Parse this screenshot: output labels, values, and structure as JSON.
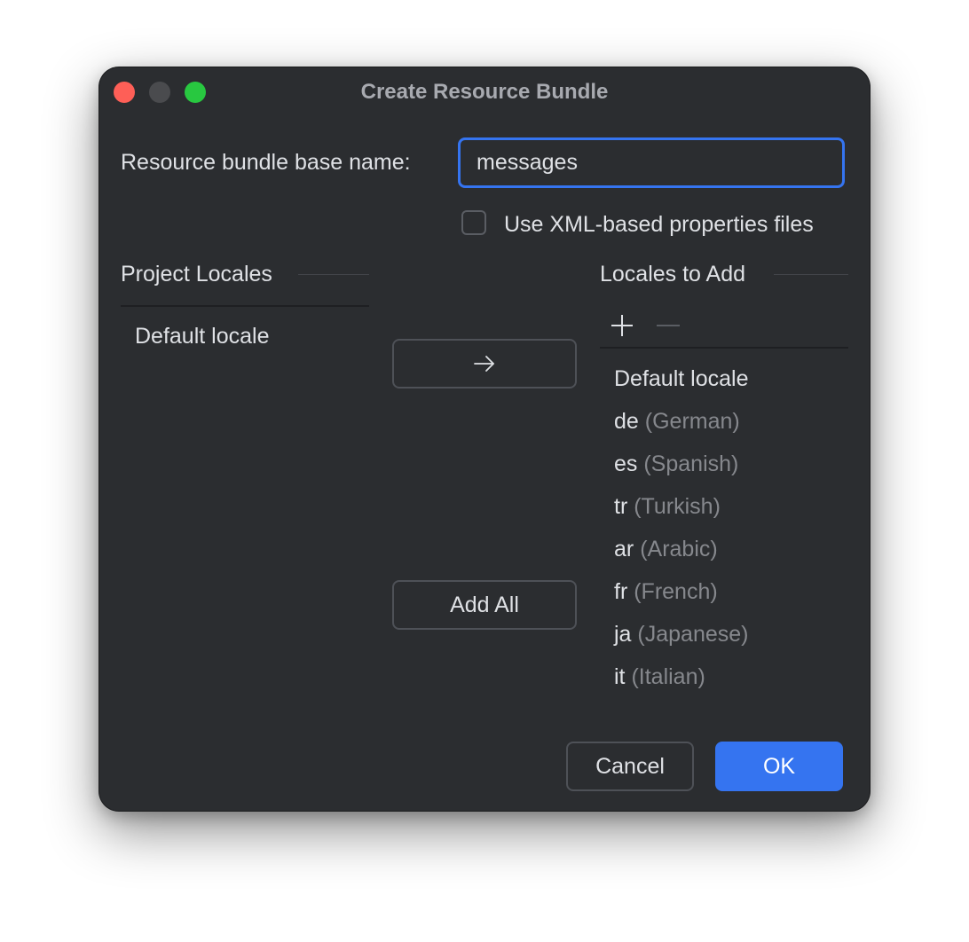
{
  "window": {
    "title": "Create Resource Bundle"
  },
  "form": {
    "base_name_label": "Resource bundle base name:",
    "base_name_value": "messages",
    "xml_checkbox_label": "Use XML-based properties files",
    "xml_checkbox_checked": false
  },
  "project_locales": {
    "header": "Project Locales",
    "items": [
      {
        "label": "Default locale"
      }
    ]
  },
  "transfer": {
    "move_icon": "arrow-right-icon",
    "add_all_label": "Add All"
  },
  "locales_to_add": {
    "header": "Locales to Add",
    "toolbar": {
      "add_icon": "plus-icon",
      "remove_icon": "minus-icon"
    },
    "items": [
      {
        "code": "Default locale",
        "name": ""
      },
      {
        "code": "de",
        "name": "(German)"
      },
      {
        "code": "es",
        "name": "(Spanish)"
      },
      {
        "code": "tr",
        "name": "(Turkish)"
      },
      {
        "code": "ar",
        "name": "(Arabic)"
      },
      {
        "code": "fr",
        "name": "(French)"
      },
      {
        "code": "ja",
        "name": "(Japanese)"
      },
      {
        "code": "it",
        "name": "(Italian)"
      }
    ]
  },
  "footer": {
    "cancel_label": "Cancel",
    "ok_label": "OK"
  },
  "colors": {
    "accent": "#3574f0",
    "window_bg": "#2b2d30",
    "text": "#dfe1e5",
    "muted_text": "#86888d"
  }
}
